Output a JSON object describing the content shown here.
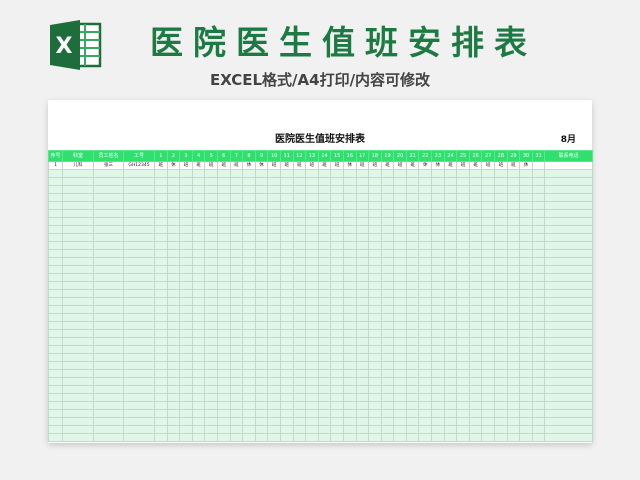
{
  "banner": {
    "title": "医院医生值班安排表",
    "subtitle": "EXCEL格式/A4打印/内容可修改",
    "logo_letter": "X",
    "colors": {
      "title": "#1e7a43",
      "logo_dark": "#1e6e3c",
      "logo_light": "#3aa865"
    }
  },
  "sheet": {
    "title": "医院医生值班安排表",
    "month": "8月",
    "columns": [
      "序号",
      "科室",
      "员工姓名",
      "工号",
      "1",
      "2",
      "3",
      "4",
      "5",
      "6",
      "7",
      "8",
      "9",
      "10",
      "11",
      "12",
      "13",
      "14",
      "15",
      "16",
      "17",
      "18",
      "19",
      "20",
      "21",
      "22",
      "23",
      "24",
      "25",
      "26",
      "27",
      "28",
      "29",
      "30",
      "31",
      "联系电话"
    ],
    "rows": [
      [
        "1",
        "儿科",
        "张三",
        "GH12345",
        "班",
        "休",
        "班",
        "班",
        "班",
        "班",
        "班",
        "休",
        "休",
        "班",
        "班",
        "班",
        "班",
        "班",
        "班",
        "休",
        "班",
        "班",
        "班",
        "班",
        "班",
        "休",
        "休",
        "班",
        "班",
        "班",
        "班",
        "班",
        "班",
        "休",
        "",
        ""
      ]
    ],
    "empty_row_count": 34,
    "colors": {
      "header": "#2fe06f",
      "body": "#dff6e9",
      "grid_line": "#b9ddc6"
    }
  }
}
